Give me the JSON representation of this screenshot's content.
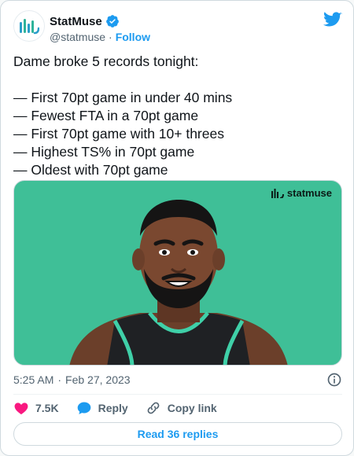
{
  "author": {
    "display_name": "StatMuse",
    "handle": "@statmuse",
    "separator": "·",
    "follow_label": "Follow",
    "verified": true
  },
  "tweet": {
    "text": "Dame broke 5 records tonight:\n\n— First 70pt game in under 40 mins\n— Fewest FTA in a 70pt game\n— First 70pt game with 10+ threes\n— Highest TS% in 70pt game\n— Oldest with 70pt game"
  },
  "media": {
    "watermark": "statmuse",
    "background_color": "#3fbf97"
  },
  "meta": {
    "time": "5:25 AM",
    "separator": "·",
    "date": "Feb 27, 2023"
  },
  "actions": {
    "like_count": "7.5K",
    "reply_label": "Reply",
    "copy_link_label": "Copy link"
  },
  "replies_button": {
    "label": "Read 36 replies"
  },
  "colors": {
    "accent": "#1d9bf0",
    "like": "#f91880",
    "text_secondary": "#536471"
  },
  "icons": [
    "statmuse-logo-icon",
    "verified-badge-icon",
    "twitter-bird-icon",
    "info-icon",
    "heart-icon",
    "reply-bubble-icon",
    "link-icon"
  ]
}
